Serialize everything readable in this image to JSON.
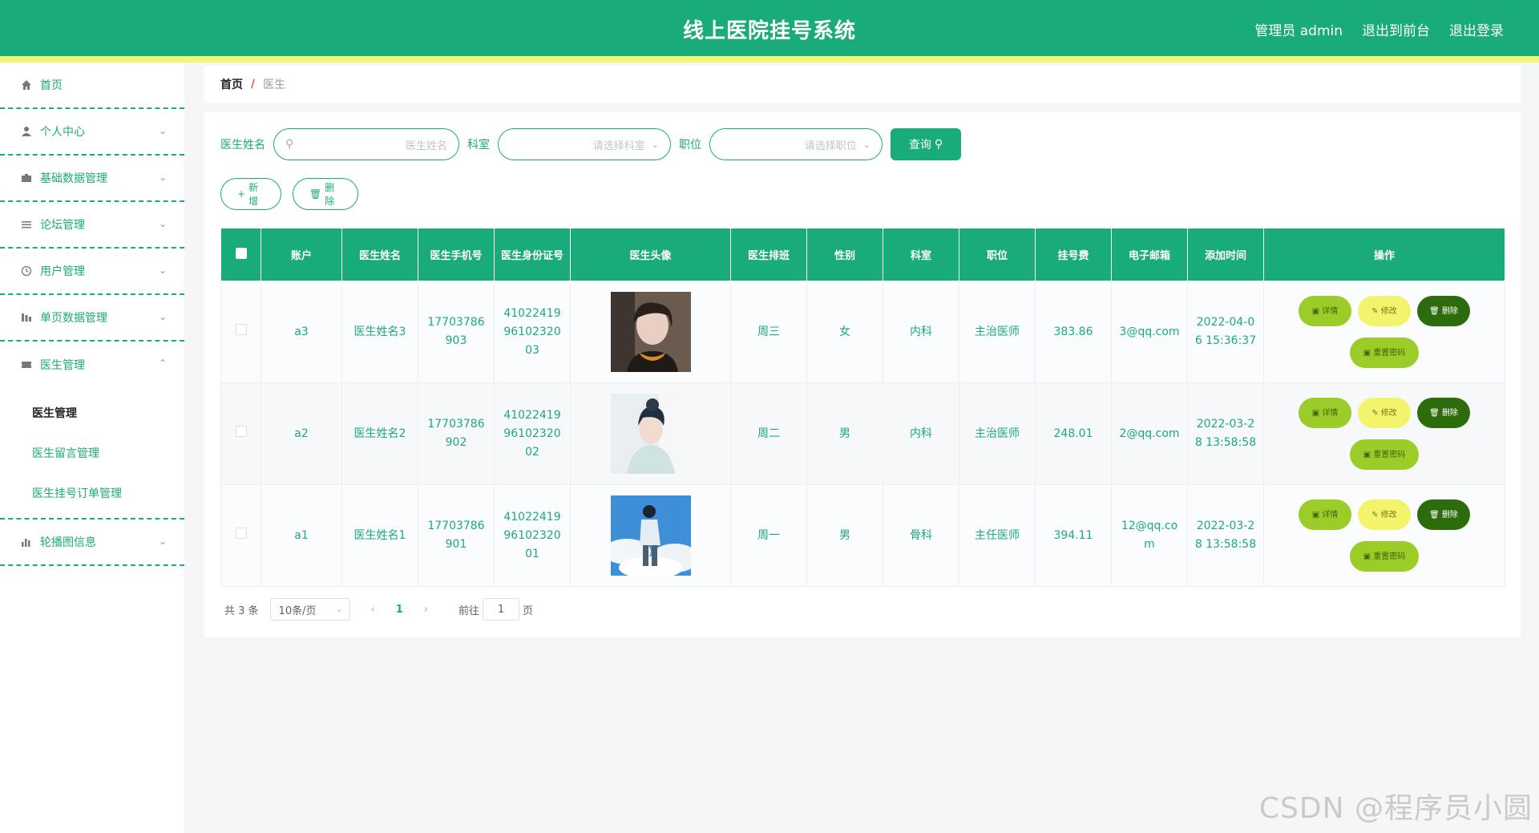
{
  "header": {
    "title": "线上医院挂号系统",
    "admin_label": "管理员 admin",
    "exit_front": "退出到前台",
    "logout": "退出登录"
  },
  "sidebar": {
    "items": [
      {
        "label": "首页",
        "icon": "home-icon"
      },
      {
        "label": "个人中心",
        "icon": "user-icon"
      },
      {
        "label": "基础数据管理",
        "icon": "briefcase-icon"
      },
      {
        "label": "论坛管理",
        "icon": "list-icon"
      },
      {
        "label": "用户管理",
        "icon": "clock-icon"
      },
      {
        "label": "单页数据管理",
        "icon": "chart-icon"
      },
      {
        "label": "医生管理",
        "icon": "ticket-icon"
      },
      {
        "label": "轮播图信息",
        "icon": "bar-chart-icon"
      }
    ],
    "doctor_sub": [
      "医生管理",
      "医生留言管理",
      "医生挂号订单管理"
    ]
  },
  "breadcrumb": {
    "home": "首页",
    "sep": "/",
    "current": "医生"
  },
  "search": {
    "name_label": "医生姓名",
    "name_placeholder": "医生姓名",
    "dept_label": "科室",
    "dept_placeholder": "请选择科室",
    "pos_label": "职位",
    "pos_placeholder": "请选择职位",
    "query_button": "查询"
  },
  "actions": {
    "add": "新增",
    "delete": "删除"
  },
  "table": {
    "headers": [
      "账户",
      "医生姓名",
      "医生手机号",
      "医生身份证号",
      "医生头像",
      "医生排班",
      "性别",
      "科室",
      "职位",
      "挂号费",
      "电子邮箱",
      "添加时间",
      "操作"
    ],
    "rows": [
      {
        "account": "a3",
        "name": "医生姓名3",
        "phone": "17703786903",
        "id_card": "410224199610232003",
        "schedule": "周三",
        "gender": "女",
        "dept": "内科",
        "position": "主治医师",
        "fee": "383.86",
        "email": "3@qq.com",
        "time": "2022-04-06 15:36:37"
      },
      {
        "account": "a2",
        "name": "医生姓名2",
        "phone": "17703786902",
        "id_card": "410224199610232002",
        "schedule": "周二",
        "gender": "男",
        "dept": "内科",
        "position": "主治医师",
        "fee": "248.01",
        "email": "2@qq.com",
        "time": "2022-03-28 13:58:58"
      },
      {
        "account": "a1",
        "name": "医生姓名1",
        "phone": "17703786901",
        "id_card": "410224199610232001",
        "schedule": "周一",
        "gender": "男",
        "dept": "骨科",
        "position": "主任医师",
        "fee": "394.11",
        "email": "12@qq.com",
        "time": "2022-03-28 13:58:58"
      }
    ],
    "ops": {
      "detail": "详情",
      "edit": "修改",
      "delete": "删除",
      "reset": "重置密码"
    }
  },
  "pagination": {
    "total": "共 3 条",
    "page_size": "10条/页",
    "current": "1",
    "goto_label": "前往",
    "goto_value": "1",
    "page_suffix": "页"
  },
  "watermark": "CSDN @程序员小圆",
  "colors": {
    "primary": "#1aab7a",
    "stripe": "#eef776",
    "detail": "#9ccc28",
    "edit": "#f2f56b",
    "delete": "#2d6c0d"
  }
}
